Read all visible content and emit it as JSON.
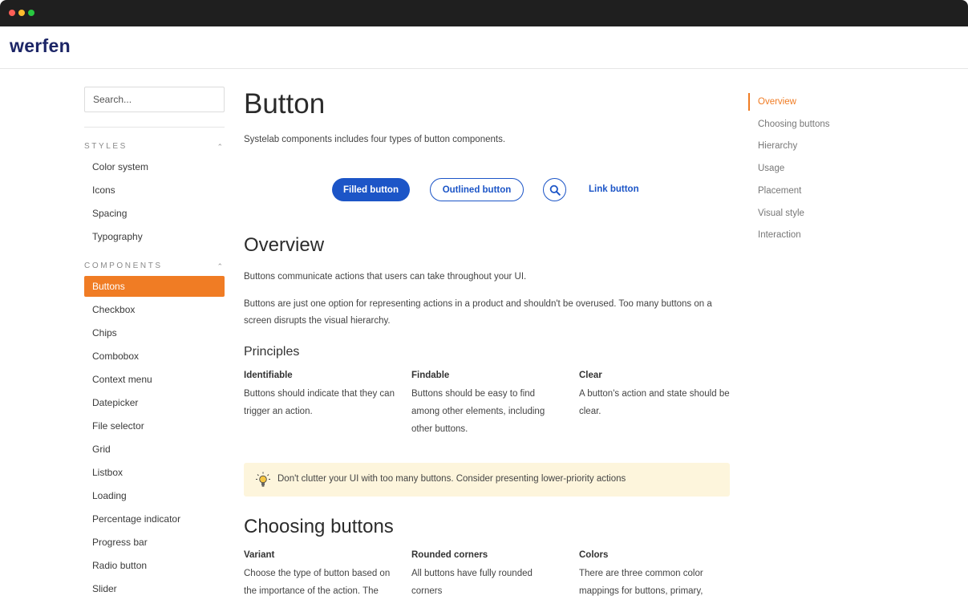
{
  "window": {
    "dot_colors": [
      "#ff5f57",
      "#febc2e",
      "#28c840"
    ]
  },
  "brand": {
    "logo": "werfen",
    "color": "#1c2566"
  },
  "sidebar": {
    "search_placeholder": "Search...",
    "sections": [
      {
        "title": "STYLES",
        "items": [
          "Color system",
          "Icons",
          "Spacing",
          "Typography"
        ]
      },
      {
        "title": "COMPONENTS",
        "items": [
          "Buttons",
          "Checkbox",
          "Chips",
          "Combobox",
          "Context menu",
          "Datepicker",
          "File selector",
          "Grid",
          "Listbox",
          "Loading",
          "Percentage indicator",
          "Progress bar",
          "Radio button",
          "Slider"
        ]
      }
    ],
    "active_item": "Buttons",
    "active_color": "#f07c24"
  },
  "main": {
    "title": "Button",
    "intro": "Systelab components includes four types of button components.",
    "demo": {
      "filled": "Filled button",
      "outlined": "Outlined button",
      "icon": "search-icon",
      "link": "Link button",
      "accent": "#1c55c7"
    },
    "overview": {
      "heading": "Overview",
      "p1": "Buttons communicate actions that users can take throughout your UI.",
      "p2": "Buttons are just one option for representing actions in a product and shouldn't be overused. Too many buttons on a screen disrupts the visual hierarchy."
    },
    "principles": {
      "heading": "Principles",
      "items": [
        {
          "title": "Identifiable",
          "text": "Buttons should indicate that they can trigger an action."
        },
        {
          "title": "Findable",
          "text": "Buttons should be easy to find among other elements, including other buttons."
        },
        {
          "title": "Clear",
          "text": "A button's action and state should be clear."
        }
      ]
    },
    "tip": {
      "icon": "lightbulb-icon",
      "text": "Don't clutter your UI with too many buttons. Consider presenting lower-priority actions"
    },
    "choosing": {
      "heading": "Choosing buttons",
      "items": [
        {
          "title": "Variant",
          "text": "Choose the type of button based on the importance of the action. The"
        },
        {
          "title": "Rounded corners",
          "text": "All buttons have fully rounded corners"
        },
        {
          "title": "Colors",
          "text": "There are three common color mappings for buttons, primary,"
        }
      ]
    }
  },
  "toc": {
    "items": [
      "Overview",
      "Choosing buttons",
      "Hierarchy",
      "Usage",
      "Placement",
      "Visual style",
      "Interaction"
    ],
    "active": "Overview"
  }
}
